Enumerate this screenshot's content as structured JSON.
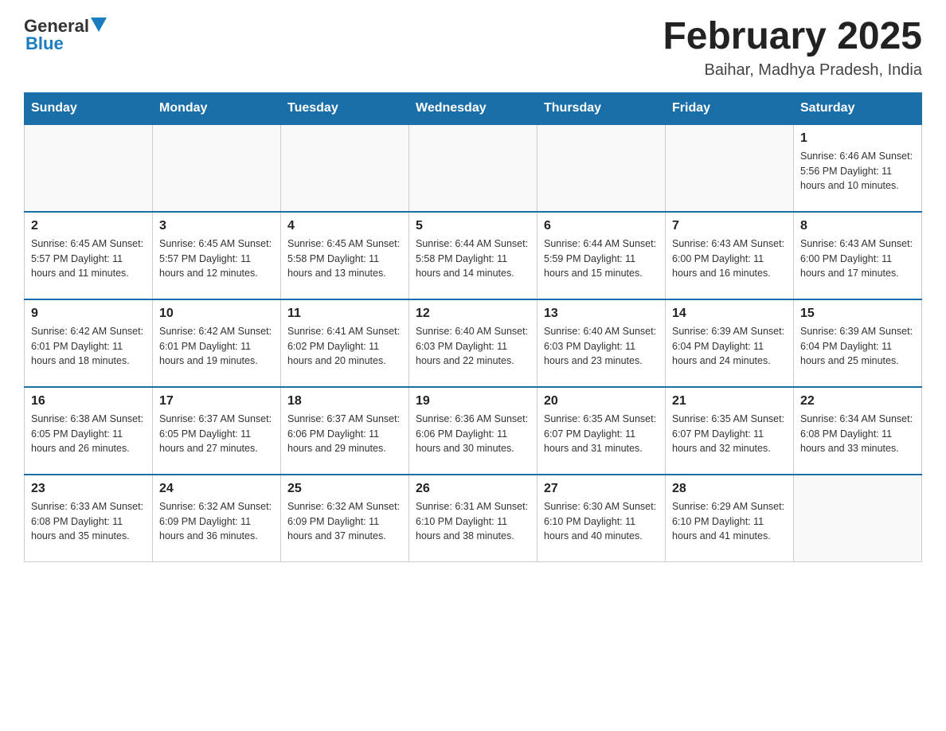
{
  "header": {
    "logo_general": "General",
    "logo_blue": "Blue",
    "title": "February 2025",
    "subtitle": "Baihar, Madhya Pradesh, India"
  },
  "days_of_week": [
    "Sunday",
    "Monday",
    "Tuesday",
    "Wednesday",
    "Thursday",
    "Friday",
    "Saturday"
  ],
  "weeks": [
    [
      {
        "day": "",
        "info": ""
      },
      {
        "day": "",
        "info": ""
      },
      {
        "day": "",
        "info": ""
      },
      {
        "day": "",
        "info": ""
      },
      {
        "day": "",
        "info": ""
      },
      {
        "day": "",
        "info": ""
      },
      {
        "day": "1",
        "info": "Sunrise: 6:46 AM\nSunset: 5:56 PM\nDaylight: 11 hours and 10 minutes."
      }
    ],
    [
      {
        "day": "2",
        "info": "Sunrise: 6:45 AM\nSunset: 5:57 PM\nDaylight: 11 hours and 11 minutes."
      },
      {
        "day": "3",
        "info": "Sunrise: 6:45 AM\nSunset: 5:57 PM\nDaylight: 11 hours and 12 minutes."
      },
      {
        "day": "4",
        "info": "Sunrise: 6:45 AM\nSunset: 5:58 PM\nDaylight: 11 hours and 13 minutes."
      },
      {
        "day": "5",
        "info": "Sunrise: 6:44 AM\nSunset: 5:58 PM\nDaylight: 11 hours and 14 minutes."
      },
      {
        "day": "6",
        "info": "Sunrise: 6:44 AM\nSunset: 5:59 PM\nDaylight: 11 hours and 15 minutes."
      },
      {
        "day": "7",
        "info": "Sunrise: 6:43 AM\nSunset: 6:00 PM\nDaylight: 11 hours and 16 minutes."
      },
      {
        "day": "8",
        "info": "Sunrise: 6:43 AM\nSunset: 6:00 PM\nDaylight: 11 hours and 17 minutes."
      }
    ],
    [
      {
        "day": "9",
        "info": "Sunrise: 6:42 AM\nSunset: 6:01 PM\nDaylight: 11 hours and 18 minutes."
      },
      {
        "day": "10",
        "info": "Sunrise: 6:42 AM\nSunset: 6:01 PM\nDaylight: 11 hours and 19 minutes."
      },
      {
        "day": "11",
        "info": "Sunrise: 6:41 AM\nSunset: 6:02 PM\nDaylight: 11 hours and 20 minutes."
      },
      {
        "day": "12",
        "info": "Sunrise: 6:40 AM\nSunset: 6:03 PM\nDaylight: 11 hours and 22 minutes."
      },
      {
        "day": "13",
        "info": "Sunrise: 6:40 AM\nSunset: 6:03 PM\nDaylight: 11 hours and 23 minutes."
      },
      {
        "day": "14",
        "info": "Sunrise: 6:39 AM\nSunset: 6:04 PM\nDaylight: 11 hours and 24 minutes."
      },
      {
        "day": "15",
        "info": "Sunrise: 6:39 AM\nSunset: 6:04 PM\nDaylight: 11 hours and 25 minutes."
      }
    ],
    [
      {
        "day": "16",
        "info": "Sunrise: 6:38 AM\nSunset: 6:05 PM\nDaylight: 11 hours and 26 minutes."
      },
      {
        "day": "17",
        "info": "Sunrise: 6:37 AM\nSunset: 6:05 PM\nDaylight: 11 hours and 27 minutes."
      },
      {
        "day": "18",
        "info": "Sunrise: 6:37 AM\nSunset: 6:06 PM\nDaylight: 11 hours and 29 minutes."
      },
      {
        "day": "19",
        "info": "Sunrise: 6:36 AM\nSunset: 6:06 PM\nDaylight: 11 hours and 30 minutes."
      },
      {
        "day": "20",
        "info": "Sunrise: 6:35 AM\nSunset: 6:07 PM\nDaylight: 11 hours and 31 minutes."
      },
      {
        "day": "21",
        "info": "Sunrise: 6:35 AM\nSunset: 6:07 PM\nDaylight: 11 hours and 32 minutes."
      },
      {
        "day": "22",
        "info": "Sunrise: 6:34 AM\nSunset: 6:08 PM\nDaylight: 11 hours and 33 minutes."
      }
    ],
    [
      {
        "day": "23",
        "info": "Sunrise: 6:33 AM\nSunset: 6:08 PM\nDaylight: 11 hours and 35 minutes."
      },
      {
        "day": "24",
        "info": "Sunrise: 6:32 AM\nSunset: 6:09 PM\nDaylight: 11 hours and 36 minutes."
      },
      {
        "day": "25",
        "info": "Sunrise: 6:32 AM\nSunset: 6:09 PM\nDaylight: 11 hours and 37 minutes."
      },
      {
        "day": "26",
        "info": "Sunrise: 6:31 AM\nSunset: 6:10 PM\nDaylight: 11 hours and 38 minutes."
      },
      {
        "day": "27",
        "info": "Sunrise: 6:30 AM\nSunset: 6:10 PM\nDaylight: 11 hours and 40 minutes."
      },
      {
        "day": "28",
        "info": "Sunrise: 6:29 AM\nSunset: 6:10 PM\nDaylight: 11 hours and 41 minutes."
      },
      {
        "day": "",
        "info": ""
      }
    ]
  ]
}
